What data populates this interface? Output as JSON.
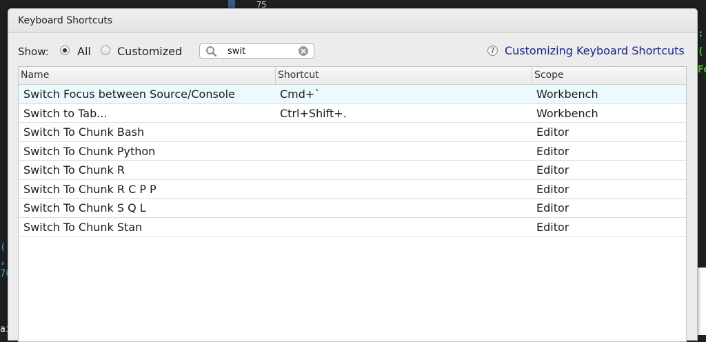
{
  "background": {
    "line_number": "75"
  },
  "dialog": {
    "title": "Keyboard Shortcuts",
    "show_label": "Show:",
    "filter_options": [
      {
        "label": "All",
        "selected": true
      },
      {
        "label": "Customized",
        "selected": false
      }
    ],
    "search": {
      "value": "swit"
    },
    "help_link": "Customizing Keyboard Shortcuts"
  },
  "table": {
    "columns": [
      "Name",
      "Shortcut",
      "Scope"
    ],
    "rows": [
      {
        "name": "Switch Focus between Source/Console",
        "shortcut": "Cmd+`",
        "scope": "Workbench"
      },
      {
        "name": "Switch to Tab...",
        "shortcut": "Ctrl+Shift+.",
        "scope": "Workbench"
      },
      {
        "name": "Switch To Chunk Bash",
        "shortcut": "",
        "scope": "Editor"
      },
      {
        "name": "Switch To Chunk Python",
        "shortcut": "",
        "scope": "Editor"
      },
      {
        "name": "Switch To Chunk R",
        "shortcut": "",
        "scope": "Editor"
      },
      {
        "name": "Switch To Chunk R C P P",
        "shortcut": "",
        "scope": "Editor"
      },
      {
        "name": "Switch To Chunk S Q L",
        "shortcut": "",
        "scope": "Editor"
      },
      {
        "name": "Switch To Chunk Stan",
        "shortcut": "",
        "scope": "Editor"
      }
    ]
  }
}
